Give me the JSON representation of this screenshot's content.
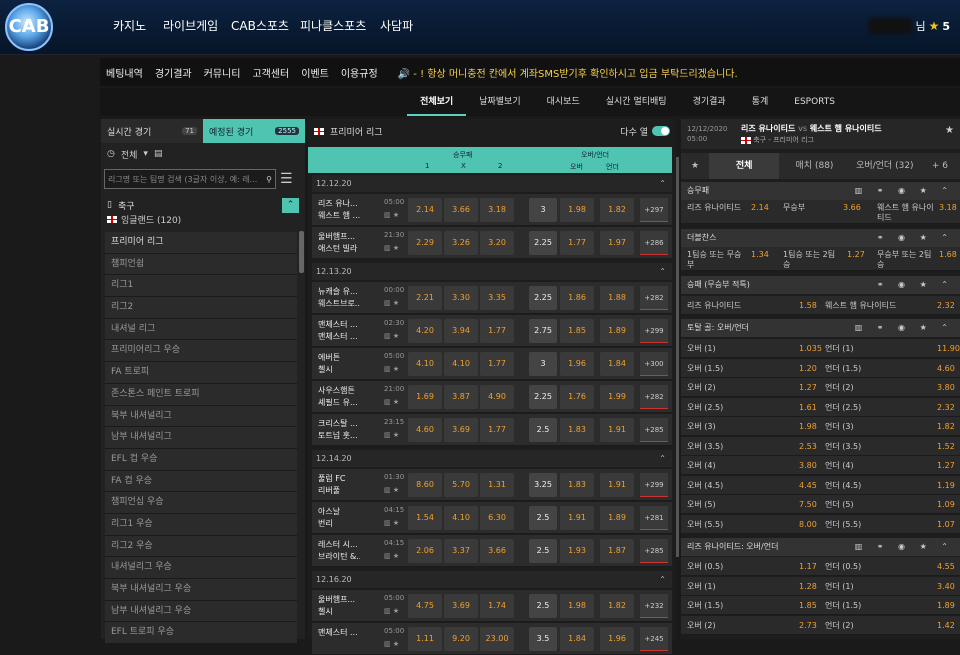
{
  "brand": {
    "logo_text": "CAB"
  },
  "top_menu": [
    "카지노",
    "라이브게임",
    "CAB스포츠",
    "피나클스포츠",
    "사담파"
  ],
  "user": {
    "suffix": "님",
    "count": "5"
  },
  "sub_menu": [
    "베팅내역",
    "경기결과",
    "커뮤니티",
    "고객센터",
    "이벤트",
    "이용규정"
  ],
  "notice": "🔊 - ! 항상 머니충전 칸에서 계좌SMS받기후 확인하시고 입금 부탁드리겠습니다.",
  "main_tabs": [
    "전체보기",
    "날짜별보기",
    "대시보드",
    "실시간 멀티배팅",
    "경기결과",
    "통계",
    "ESPORTS"
  ],
  "left": {
    "tab_live": "실시간 경기",
    "tab_live_count": "71",
    "tab_sched": "예정된 경기",
    "tab_sched_count": "2555",
    "filter": "전체",
    "search_placeholder": "리그명 또는 팀명 검색 (3글자 이상, 예: 레...",
    "sport": "축구",
    "region": "잉글랜드 (120)",
    "leagues": [
      "프리미어 리그",
      "챔피언쉽",
      "리그1",
      "리그2",
      "내셔널 리그",
      "프리미어리그 우승",
      "FA 트로피",
      "존스톤스 페인트 트로피",
      "북부 내셔널리그",
      "남부 내셔널리그",
      "EFL 컵 우승",
      "FA 컵 우승",
      "챔피언십 우승",
      "리그1 우승",
      "리그2 우승",
      "내셔널리그 우승",
      "북부 내셔널리그 우승",
      "남부 내셔널리그 우승",
      "EFL 트로피 우승"
    ]
  },
  "center": {
    "league": "프리미어 리그",
    "multi_label": "다수 열",
    "col_winlose": "승무패",
    "col_ou": "오버/언더",
    "col_1": "1",
    "col_x": "X",
    "col_2": "2",
    "col_over": "오버",
    "col_under": "언더",
    "groups": [
      {
        "date": "12.12.20",
        "matches": [
          {
            "home": "리즈 유나...",
            "away": "웨스트 햄 ...",
            "time": "05:00",
            "o1": "2.14",
            "ox": "3.66",
            "o2": "3.18",
            "line": "3",
            "ov": "1.98",
            "un": "1.82",
            "more": "+297"
          },
          {
            "home": "울버햄프...",
            "away": "애스턴 빌라",
            "time": "21:30",
            "o1": "2.29",
            "ox": "3.26",
            "o2": "3.20",
            "line": "2.25",
            "ov": "1.77",
            "un": "1.97",
            "more": "+286"
          }
        ]
      },
      {
        "date": "12.13.20",
        "matches": [
          {
            "home": "뉴캐슬 유...",
            "away": "웨스트브로...",
            "time": "00:00",
            "o1": "2.21",
            "ox": "3.30",
            "o2": "3.35",
            "line": "2.25",
            "ov": "1.86",
            "un": "1.88",
            "more": "+282"
          },
          {
            "home": "맨체스터 ...",
            "away": "맨체스터 ...",
            "time": "02:30",
            "o1": "4.20",
            "ox": "3.94",
            "o2": "1.77",
            "line": "2.75",
            "ov": "1.85",
            "un": "1.89",
            "more": "+299"
          },
          {
            "home": "에버튼",
            "away": "첼시",
            "time": "05:00",
            "o1": "4.10",
            "ox": "4.10",
            "o2": "1.77",
            "line": "3",
            "ov": "1.96",
            "un": "1.84",
            "more": "+300"
          },
          {
            "home": "사우스햄튼",
            "away": "셰필드 유...",
            "time": "21:00",
            "o1": "1.69",
            "ox": "3.87",
            "o2": "4.90",
            "line": "2.25",
            "ov": "1.76",
            "un": "1.99",
            "more": "+282"
          },
          {
            "home": "크리스탈 ...",
            "away": "토트넘 홋...",
            "time": "23:15",
            "o1": "4.60",
            "ox": "3.69",
            "o2": "1.77",
            "line": "2.5",
            "ov": "1.83",
            "un": "1.91",
            "more": "+285"
          }
        ]
      },
      {
        "date": "12.14.20",
        "matches": [
          {
            "home": "풀럼 FC",
            "away": "리버풀",
            "time": "01:30",
            "o1": "8.60",
            "ox": "5.70",
            "o2": "1.31",
            "line": "3.25",
            "ov": "1.83",
            "un": "1.91",
            "more": "+299"
          },
          {
            "home": "아스날",
            "away": "번리",
            "time": "04:15",
            "o1": "1.54",
            "ox": "4.10",
            "o2": "6.30",
            "line": "2.5",
            "ov": "1.91",
            "un": "1.89",
            "more": "+281"
          },
          {
            "home": "레스터 시...",
            "away": "브라이턴 &...",
            "time": "04:15",
            "o1": "2.06",
            "ox": "3.37",
            "o2": "3.66",
            "line": "2.5",
            "ov": "1.93",
            "un": "1.87",
            "more": "+285"
          }
        ]
      },
      {
        "date": "12.16.20",
        "matches": [
          {
            "home": "울버햄프...",
            "away": "첼시",
            "time": "05:00",
            "o1": "4.75",
            "ox": "3.69",
            "o2": "1.74",
            "line": "2.5",
            "ov": "1.98",
            "un": "1.82",
            "more": "+232"
          },
          {
            "home": "맨체스터 ...",
            "away": "",
            "time": "05:00",
            "o1": "1.11",
            "ox": "9.20",
            "o2": "23.00",
            "line": "3.5",
            "ov": "1.84",
            "un": "1.96",
            "more": "+245"
          }
        ]
      }
    ]
  },
  "right": {
    "date": "12/12/2020",
    "time": "05:00",
    "home": "리즈 유나이티드",
    "vs": "vs",
    "away": "웨스트 햄 유나이티드",
    "sub": "축구 - 프리미어 리그",
    "tabs": [
      "전체",
      "매치 (88)",
      "오버/언더 (32)",
      "+ 6"
    ],
    "wl_title": "승무패",
    "wl": {
      "h": "리즈 유나이티드",
      "hv": "2.14",
      "d": "무승부",
      "dv": "3.66",
      "a": "웨스트 햄 유나이티드",
      "av": "3.18"
    },
    "dc_title": "더블찬스",
    "dc": {
      "a": "1팀승 또는 무승부",
      "av": "1.34",
      "b": "1팀승 또는 2팀승",
      "bv": "1.27",
      "c": "무승부 또는 2팀승",
      "cv": "1.68"
    },
    "dnb_title": "승패 (무승부 적특)",
    "dnb": {
      "h": "리즈 유나이티드",
      "hv": "1.58",
      "a": "웨스트 햄 유나이티드",
      "av": "2.32"
    },
    "ou_title": "토탈 골: 오버/언더",
    "ou": [
      {
        "o": "오버 (1)",
        "ov": "1.035",
        "u": "언더 (1)",
        "uv": "11.90"
      },
      {
        "o": "오버 (1.5)",
        "ov": "1.20",
        "u": "언더 (1.5)",
        "uv": "4.60"
      },
      {
        "o": "오버 (2)",
        "ov": "1.27",
        "u": "언더 (2)",
        "uv": "3.80"
      },
      {
        "o": "오버 (2.5)",
        "ov": "1.61",
        "u": "언더 (2.5)",
        "uv": "2.32"
      },
      {
        "o": "오버 (3)",
        "ov": "1.98",
        "u": "언더 (3)",
        "uv": "1.82"
      },
      {
        "o": "오버 (3.5)",
        "ov": "2.53",
        "u": "언더 (3.5)",
        "uv": "1.52"
      },
      {
        "o": "오버 (4)",
        "ov": "3.80",
        "u": "언더 (4)",
        "uv": "1.27"
      },
      {
        "o": "오버 (4.5)",
        "ov": "4.45",
        "u": "언더 (4.5)",
        "uv": "1.19"
      },
      {
        "o": "오버 (5)",
        "ov": "7.50",
        "u": "언더 (5)",
        "uv": "1.09"
      },
      {
        "o": "오버 (5.5)",
        "ov": "8.00",
        "u": "언더 (5.5)",
        "uv": "1.07"
      }
    ],
    "hou_title": "리즈 유나이티드: 오버/언더",
    "hou": [
      {
        "o": "오버 (0.5)",
        "ov": "1.17",
        "u": "언더 (0.5)",
        "uv": "4.55"
      },
      {
        "o": "오버 (1)",
        "ov": "1.28",
        "u": "언더 (1)",
        "uv": "3.40"
      },
      {
        "o": "오버 (1.5)",
        "ov": "1.85",
        "u": "언더 (1.5)",
        "uv": "1.89"
      },
      {
        "o": "오버 (2)",
        "ov": "2.73",
        "u": "언더 (2)",
        "uv": "1.42"
      }
    ]
  }
}
